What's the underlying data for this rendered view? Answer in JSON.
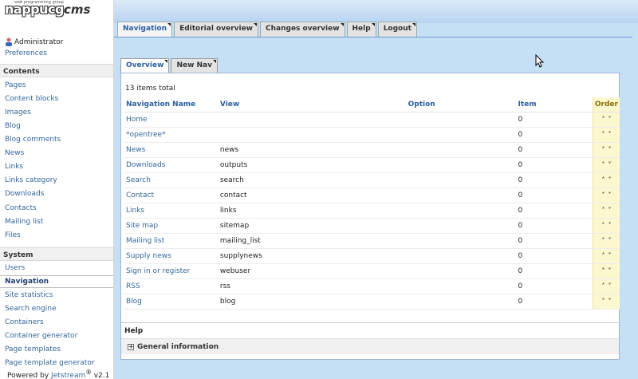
{
  "logo": {
    "brand": "nappu",
    "brand_mid": "cg",
    "brand_tail": "cms",
    "subtitle": "web programming group"
  },
  "sidebar": {
    "user": "Administrator",
    "preferences": "Preferences",
    "sections": [
      {
        "title": "Contents",
        "items": [
          "Pages",
          "Content blocks",
          "Images",
          "Blog",
          "Blog comments",
          "News",
          "Links",
          "Links category",
          "Downloads",
          "Contacts",
          "Mailing list",
          "Files"
        ]
      },
      {
        "title": "System",
        "items": [
          "Users",
          "Navigation",
          "Site statistics",
          "Search engine",
          "Containers",
          "Container generator",
          "Page templates",
          "Page template generator"
        ]
      }
    ],
    "active_item": "Navigation"
  },
  "topnav": {
    "tabs": [
      "Navigation",
      "Editorial overview",
      "Changes overview",
      "Help",
      "Logout"
    ],
    "selected": "Navigation"
  },
  "subnav": {
    "tabs": [
      "Overview",
      "New Nav"
    ],
    "selected": "Overview"
  },
  "table": {
    "total": "13 items total",
    "headers": [
      "Navigation Name",
      "View",
      "Option",
      "Item",
      "Order"
    ],
    "rows": [
      {
        "name": "Home",
        "view": "",
        "option": "",
        "item": "0"
      },
      {
        "name": "*opentree*",
        "view": "",
        "option": "",
        "item": "0"
      },
      {
        "name": "News",
        "view": "news",
        "option": "",
        "item": "0"
      },
      {
        "name": "Downloads",
        "view": "outputs",
        "option": "",
        "item": "0"
      },
      {
        "name": "Search",
        "view": "search",
        "option": "",
        "item": "0"
      },
      {
        "name": "Contact",
        "view": "contact",
        "option": "",
        "item": "0"
      },
      {
        "name": "Links",
        "view": "links",
        "option": "",
        "item": "0"
      },
      {
        "name": "Site map",
        "view": "sitemap",
        "option": "",
        "item": "0"
      },
      {
        "name": "Mailing list",
        "view": "mailing_list",
        "option": "",
        "item": "0"
      },
      {
        "name": "Supply news",
        "view": "supplynews",
        "option": "",
        "item": "0"
      },
      {
        "name": "Sign in or register",
        "view": "webuser",
        "option": "",
        "item": "0"
      },
      {
        "name": "RSS",
        "view": "rss",
        "option": "",
        "item": "0"
      },
      {
        "name": "Blog",
        "view": "blog",
        "option": "",
        "item": "0"
      }
    ]
  },
  "help": {
    "title": "Help",
    "general": "General information"
  },
  "footer": {
    "prefix": "Powered by",
    "product": "Jetstream",
    "reg": "®",
    "version": "v2.1"
  },
  "colors": {
    "accent": "#2a5ea0",
    "link": "#336699",
    "main_bg": "#c5dff5",
    "order_bg": "#fbf8d0"
  }
}
